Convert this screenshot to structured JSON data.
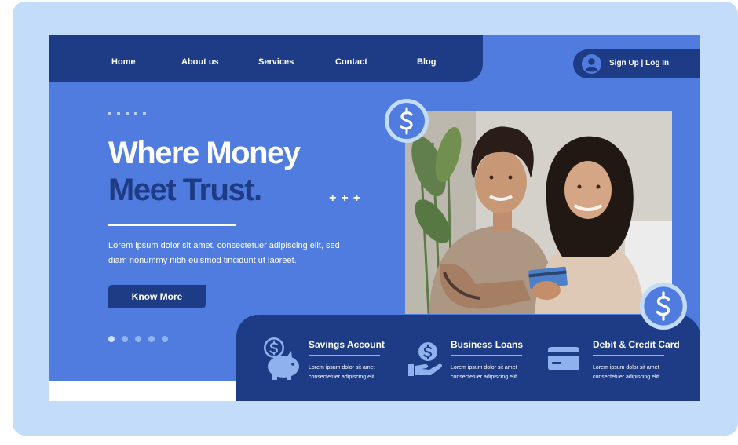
{
  "nav": {
    "items": [
      {
        "label": "Home"
      },
      {
        "label": "About us"
      },
      {
        "label": "Services"
      },
      {
        "label": "Contact"
      },
      {
        "label": "Blog"
      }
    ]
  },
  "auth": {
    "label": "Sign Up | Log In",
    "icon": "user-circle-icon"
  },
  "hero": {
    "title_line1": "Where Money",
    "title_line2": "Meet Trust.",
    "plus_marks": "+++",
    "description": "Lorem ipsum dolor sit amet, consectetuer adipiscing elit, sed diam nonummy nibh euismod tincidunt ut laoreet.",
    "button_label": "Know More",
    "carousel": {
      "count": 5,
      "active_index": 0
    }
  },
  "services": [
    {
      "title": "Savings Account",
      "text": "Lorem ipsum dolor sit amet consectetuer adipiscing elit.",
      "icon": "piggy-bank-icon"
    },
    {
      "title": "Business Loans",
      "text": "Lorem ipsum dolor sit amet consectetuer adipiscing elit.",
      "icon": "hand-coin-icon"
    },
    {
      "title": "Debit & Credit Card",
      "text": "Lorem ipsum dolor sit amet consectetuer adipiscing elit.",
      "icon": "credit-card-icon"
    }
  ],
  "colors": {
    "frame": "#c3dcfa",
    "primary": "#507ce0",
    "dark": "#1e3c85",
    "accent_light": "#8fb1ee"
  }
}
